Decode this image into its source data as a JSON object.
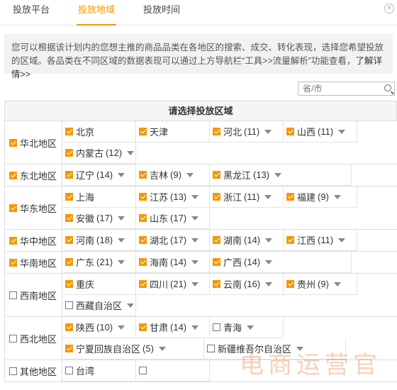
{
  "tabs": [
    "投放平台",
    "投放地域",
    "投放时间"
  ],
  "active_tab": 1,
  "close_icon": "×",
  "notice": {
    "text": "您可以根据该计划内的您想主推的商品品类在各地区的搜索、成交、转化表现，选择您希望投放的区域。各品类在不同区域的数据表现可以通过上方导航栏“工具>>流量解析”功能查看，",
    "link": "了解详情>>"
  },
  "search": {
    "placeholder": "省/市"
  },
  "table": {
    "header": "请选择投放区域",
    "groups": [
      {
        "name": "华北地区",
        "checked": true,
        "provinces": [
          {
            "name": "北京",
            "count": "",
            "checked": true,
            "caret": false
          },
          {
            "name": "天津",
            "count": "",
            "checked": true,
            "caret": false
          },
          {
            "name": "河北",
            "count": "(11)",
            "checked": true,
            "caret": true
          },
          {
            "name": "山西",
            "count": "(11)",
            "checked": true,
            "caret": true
          },
          {
            "name": "内蒙古",
            "count": "(12)",
            "checked": true,
            "caret": true
          }
        ]
      },
      {
        "name": "东北地区",
        "checked": true,
        "provinces": [
          {
            "name": "辽宁",
            "count": "(14)",
            "checked": true,
            "caret": true
          },
          {
            "name": "吉林",
            "count": "(9)",
            "checked": true,
            "caret": true
          },
          {
            "name": "黑龙江",
            "count": "(13)",
            "checked": true,
            "caret": true,
            "wide": true
          }
        ]
      },
      {
        "name": "华东地区",
        "checked": true,
        "provinces": [
          {
            "name": "上海",
            "count": "",
            "checked": true,
            "caret": false
          },
          {
            "name": "江苏",
            "count": "(13)",
            "checked": true,
            "caret": true
          },
          {
            "name": "浙江",
            "count": "(11)",
            "checked": true,
            "caret": true
          },
          {
            "name": "福建",
            "count": "(9)",
            "checked": true,
            "caret": true
          },
          {
            "name": "安徽",
            "count": "(17)",
            "checked": true,
            "caret": true
          },
          {
            "name": "山东",
            "count": "(17)",
            "checked": true,
            "caret": true
          }
        ]
      },
      {
        "name": "华中地区",
        "checked": true,
        "provinces": [
          {
            "name": "河南",
            "count": "(18)",
            "checked": true,
            "caret": true
          },
          {
            "name": "湖北",
            "count": "(17)",
            "checked": true,
            "caret": true
          },
          {
            "name": "湖南",
            "count": "(14)",
            "checked": true,
            "caret": true
          },
          {
            "name": "江西",
            "count": "(11)",
            "checked": true,
            "caret": true
          }
        ]
      },
      {
        "name": "华南地区",
        "checked": true,
        "provinces": [
          {
            "name": "广东",
            "count": "(21)",
            "checked": true,
            "caret": true
          },
          {
            "name": "海南",
            "count": "(14)",
            "checked": true,
            "caret": true
          },
          {
            "name": "广西",
            "count": "(14)",
            "checked": true,
            "caret": true,
            "wide": true
          }
        ]
      },
      {
        "name": "西南地区",
        "checked": false,
        "provinces": [
          {
            "name": "重庆",
            "count": "",
            "checked": true,
            "caret": false
          },
          {
            "name": "四川",
            "count": "(21)",
            "checked": true,
            "caret": true
          },
          {
            "name": "云南",
            "count": "(16)",
            "checked": true,
            "caret": true
          },
          {
            "name": "贵州",
            "count": "(9)",
            "checked": true,
            "caret": true
          },
          {
            "name": "西藏自治区",
            "count": "",
            "checked": false,
            "caret": true
          }
        ]
      },
      {
        "name": "西北地区",
        "checked": false,
        "provinces": [
          {
            "name": "陕西",
            "count": "(10)",
            "checked": true,
            "caret": true
          },
          {
            "name": "甘肃",
            "count": "(14)",
            "checked": true,
            "caret": true
          },
          {
            "name": "青海",
            "count": "",
            "checked": false,
            "caret": true
          },
          {
            "name": "宁夏回族自治区",
            "count": "(5)",
            "checked": true,
            "caret": true,
            "wide": true
          },
          {
            "name": "新疆维吾尔自治区",
            "count": "",
            "checked": false,
            "caret": true,
            "wide": true
          }
        ]
      },
      {
        "name": "其他地区",
        "checked": false,
        "provinces": [
          {
            "name": "台湾",
            "count": "",
            "checked": false,
            "caret": false
          },
          {
            "name": "",
            "count": "",
            "checked": false,
            "caret": false
          }
        ]
      }
    ]
  },
  "watermark": "电商运营官",
  "colors": {
    "accent": "#f39800"
  }
}
